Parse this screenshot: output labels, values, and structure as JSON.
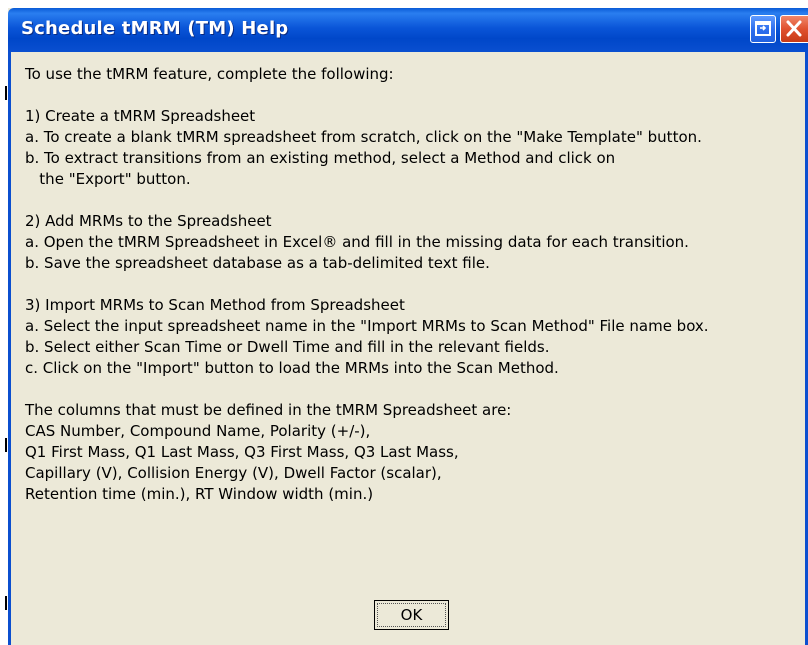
{
  "window": {
    "title": "Schedule tMRM (TM) Help",
    "icons": {
      "restore": "restore-icon",
      "close": "close-icon"
    }
  },
  "content": {
    "intro": "To use the tMRM feature, complete the following:",
    "section1": {
      "heading": "1) Create a tMRM Spreadsheet",
      "a": "a. To create a blank tMRM spreadsheet from scratch, click on the \"Make Template\" button.",
      "b1": "b. To extract transitions from an existing method, select a Method and click on",
      "b2": "   the \"Export\" button."
    },
    "section2": {
      "heading": "2) Add MRMs to the Spreadsheet",
      "a": "a. Open the tMRM Spreadsheet in Excel® and fill in the missing data for each transition.",
      "b": "b. Save the spreadsheet database as a tab-delimited text file."
    },
    "section3": {
      "heading": "3) Import MRMs to Scan Method from Spreadsheet",
      "a": "a. Select the input spreadsheet name in the \"Import MRMs to Scan Method\" File name box.",
      "b": "b. Select either Scan Time or Dwell Time and fill in the relevant fields.",
      "c": "c. Click on the \"Import\" button to load the MRMs into the Scan Method."
    },
    "columns": {
      "heading": "The columns that must be defined in the tMRM Spreadsheet are:",
      "line1": "CAS Number, Compound Name, Polarity (+/-),",
      "line2": "Q1 First Mass, Q1 Last Mass, Q3 First Mass, Q3 Last Mass,",
      "line3": "Capillary (V), Collision Energy (V), Dwell Factor (scalar),",
      "line4": "Retention time (min.), RT Window width (min.)"
    }
  },
  "buttons": {
    "ok": "OK"
  },
  "colors": {
    "titlebar": "#0a55d8",
    "dialog_bg": "#ece9d8",
    "close_button": "#e0512e",
    "restore_button": "#2f6fee"
  }
}
